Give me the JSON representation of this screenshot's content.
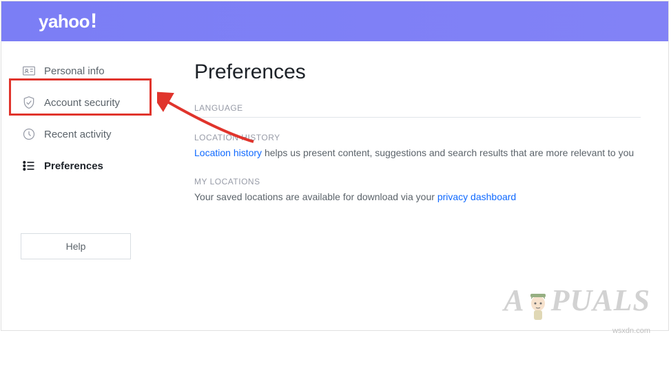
{
  "header": {
    "logo": "yahoo",
    "bang": "!"
  },
  "sidebar": {
    "items": [
      {
        "label": "Personal info"
      },
      {
        "label": "Account security"
      },
      {
        "label": "Recent activity"
      },
      {
        "label": "Preferences"
      }
    ],
    "help": "Help"
  },
  "main": {
    "title": "Preferences",
    "sections": {
      "language": {
        "label": "LANGUAGE"
      },
      "location": {
        "label": "LOCATION HISTORY",
        "link": "Location history",
        "text": " helps us present content, suggestions and search results that are more relevant to you"
      },
      "mylocations": {
        "label": "MY LOCATIONS",
        "text_before": "Your saved locations are available for download via your ",
        "link": "privacy dashboard"
      }
    }
  },
  "watermark": {
    "brand": "A  PUALS",
    "site": "wsxdn.com"
  }
}
